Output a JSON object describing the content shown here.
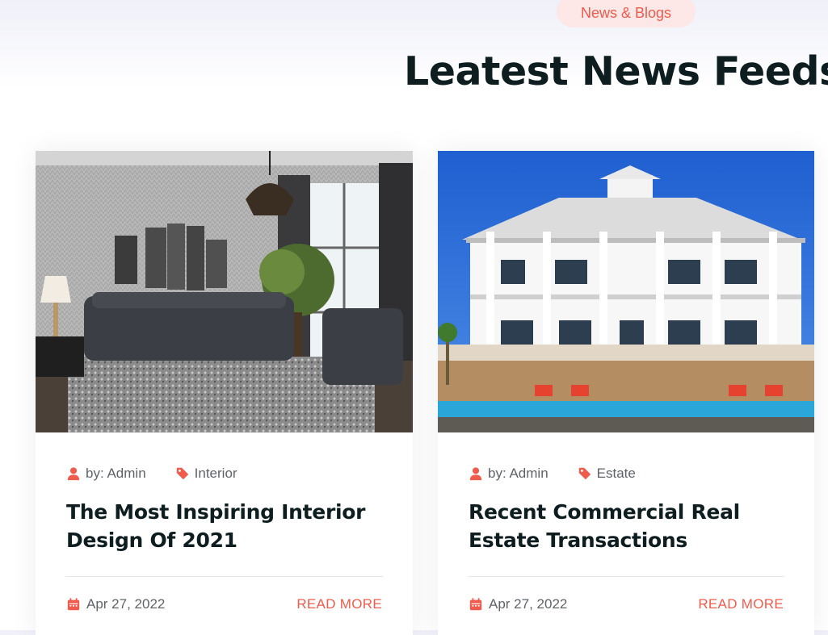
{
  "section": {
    "badge": "News & Blogs",
    "title": "Leatest News Feeds"
  },
  "colors": {
    "accent": "#ef5b4c",
    "badge_bg": "#fde7e7",
    "heading": "#0e1d20",
    "meta_text": "#5f6368"
  },
  "posts": [
    {
      "image_icon": "living-room-photo",
      "author": "by: Admin",
      "category": "Interior",
      "title": "The Most Inspiring Interior Design Of 2021",
      "date": "Apr 27, 2022",
      "read_more": "READ MORE"
    },
    {
      "image_icon": "beach-house-photo",
      "author": "by: Admin",
      "category": "Estate",
      "title": "Recent Commercial Real Estate Transactions",
      "date": "Apr 27, 2022",
      "read_more": "READ MORE"
    }
  ]
}
